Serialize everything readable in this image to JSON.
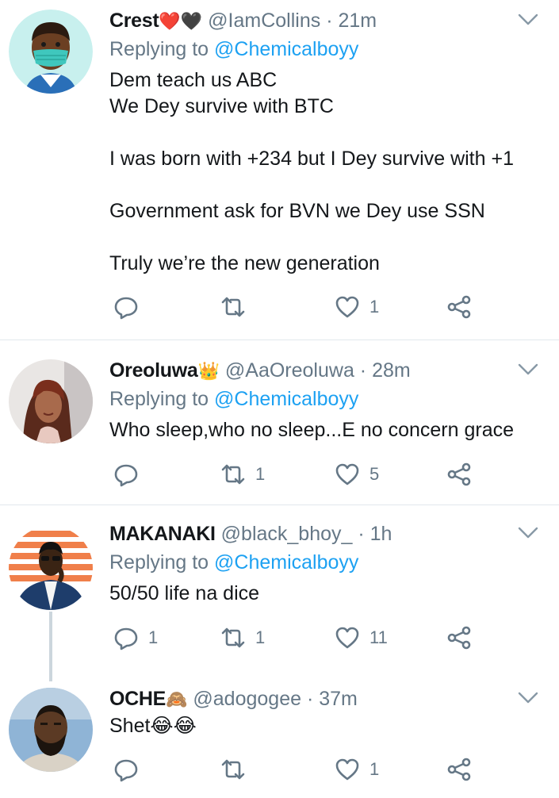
{
  "colors": {
    "link": "#1da1f2",
    "muted": "#657786",
    "text": "#14171a",
    "divider": "#e1e8ed"
  },
  "tweets": [
    {
      "name": "Crest",
      "name_emoji": "❤️🖤",
      "handle": "@IamCollins",
      "time": "21m",
      "replying_label": "Replying to",
      "replying_to": "@Chemicalboyy",
      "text": "Dem teach us ABC\nWe Dey survive with BTC\n\nI was born with +234 but I Dey survive with +1\n\nGovernment ask for BVN we Dey use SSN\n\nTruly we’re the new generation",
      "replies": "",
      "retweets": "",
      "likes": "1",
      "avatar_icon": "masked-emoji-avatar"
    },
    {
      "name": "Oreoluwa",
      "name_emoji": "👑",
      "handle": "@AaOreoluwa",
      "time": "28m",
      "replying_label": "Replying to",
      "replying_to": "@Chemicalboyy",
      "text": "Who sleep,who no sleep...E no concern grace",
      "replies": "",
      "retweets": "1",
      "likes": "5",
      "avatar_icon": "profile-photo"
    },
    {
      "name": "MAKANAKI",
      "name_emoji": "",
      "handle": "@black_bhoy_",
      "time": "1h",
      "replying_label": "Replying to",
      "replying_to": "@Chemicalboyy",
      "text": "50/50 life na dice",
      "replies": "1",
      "retweets": "1",
      "likes": "11",
      "avatar_icon": "profile-photo"
    },
    {
      "name": "OCHE",
      "name_emoji": "🙈",
      "handle": "@adogogee",
      "time": "37m",
      "text": "Shet😂😂",
      "replies": "",
      "retweets": "",
      "likes": "1",
      "avatar_icon": "profile-photo"
    }
  ]
}
